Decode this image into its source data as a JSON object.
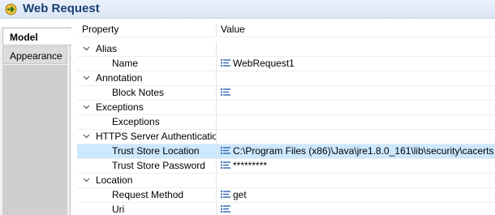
{
  "window": {
    "title": "Web Request"
  },
  "tabs": [
    {
      "label": "Model"
    },
    {
      "label": "Appearance"
    }
  ],
  "table": {
    "headers": {
      "property": "Property",
      "value": "Value"
    },
    "rows": [
      {
        "kind": "category",
        "label": "Alias"
      },
      {
        "kind": "property",
        "label": "Name",
        "value": "WebRequest1",
        "has_icon": true
      },
      {
        "kind": "category",
        "label": "Annotation"
      },
      {
        "kind": "property",
        "label": "Block Notes",
        "value": "",
        "has_icon": true
      },
      {
        "kind": "category",
        "label": "Exceptions"
      },
      {
        "kind": "property",
        "label": "Exceptions",
        "value": "",
        "has_icon": false
      },
      {
        "kind": "category",
        "label": "HTTPS Server Authentication"
      },
      {
        "kind": "property",
        "label": "Trust Store Location",
        "value": "C:\\Program Files (x86)\\Java\\jre1.8.0_161\\lib\\security\\cacerts",
        "has_icon": true,
        "selected": true
      },
      {
        "kind": "property",
        "label": "Trust Store Password",
        "value": "*********",
        "has_icon": true
      },
      {
        "kind": "category",
        "label": "Location"
      },
      {
        "kind": "property",
        "label": "Request Method",
        "value": "get",
        "has_icon": true
      },
      {
        "kind": "property",
        "label": "Uri",
        "value": "",
        "has_icon": true
      }
    ]
  },
  "colors": {
    "selection": "#cce8ff",
    "title": "#1b3f73",
    "icon_blue": "#3c6fb5"
  }
}
